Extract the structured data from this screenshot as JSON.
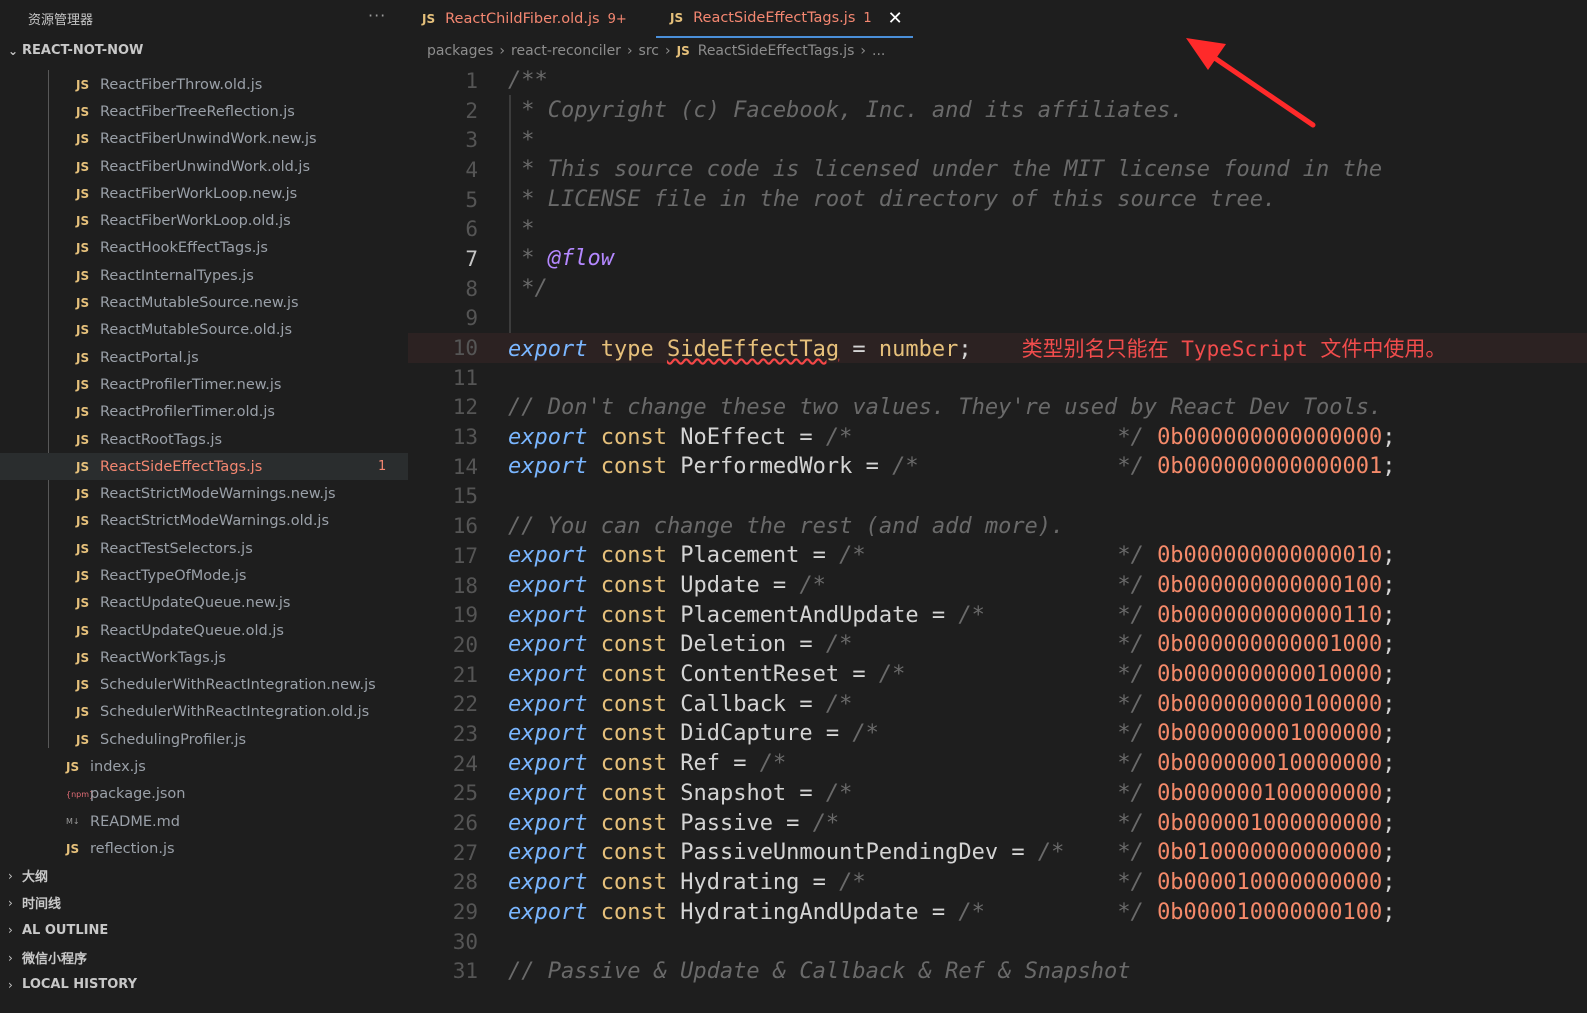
{
  "sidebar": {
    "header": "资源管理器",
    "more": "···",
    "root": "REACT-NOT-NOW",
    "files": [
      {
        "name": "ReactFiberThrow.old.js",
        "icon": "JS"
      },
      {
        "name": "ReactFiberTreeReflection.js",
        "icon": "JS"
      },
      {
        "name": "ReactFiberUnwindWork.new.js",
        "icon": "JS"
      },
      {
        "name": "ReactFiberUnwindWork.old.js",
        "icon": "JS"
      },
      {
        "name": "ReactFiberWorkLoop.new.js",
        "icon": "JS"
      },
      {
        "name": "ReactFiberWorkLoop.old.js",
        "icon": "JS"
      },
      {
        "name": "ReactHookEffectTags.js",
        "icon": "JS"
      },
      {
        "name": "ReactInternalTypes.js",
        "icon": "JS"
      },
      {
        "name": "ReactMutableSource.new.js",
        "icon": "JS"
      },
      {
        "name": "ReactMutableSource.old.js",
        "icon": "JS"
      },
      {
        "name": "ReactPortal.js",
        "icon": "JS"
      },
      {
        "name": "ReactProfilerTimer.new.js",
        "icon": "JS"
      },
      {
        "name": "ReactProfilerTimer.old.js",
        "icon": "JS"
      },
      {
        "name": "ReactRootTags.js",
        "icon": "JS"
      },
      {
        "name": "ReactSideEffectTags.js",
        "icon": "JS",
        "badge": "1"
      },
      {
        "name": "ReactStrictModeWarnings.new.js",
        "icon": "JS"
      },
      {
        "name": "ReactStrictModeWarnings.old.js",
        "icon": "JS"
      },
      {
        "name": "ReactTestSelectors.js",
        "icon": "JS"
      },
      {
        "name": "ReactTypeOfMode.js",
        "icon": "JS"
      },
      {
        "name": "ReactUpdateQueue.new.js",
        "icon": "JS"
      },
      {
        "name": "ReactUpdateQueue.old.js",
        "icon": "JS"
      },
      {
        "name": "ReactWorkTags.js",
        "icon": "JS"
      },
      {
        "name": "SchedulerWithReactIntegration.new.js",
        "icon": "JS"
      },
      {
        "name": "SchedulerWithReactIntegration.old.js",
        "icon": "JS"
      },
      {
        "name": "SchedulingProfiler.js",
        "icon": "JS"
      },
      {
        "name": "index.js",
        "icon": "JS"
      },
      {
        "name": "package.json",
        "icon": "{npm}"
      },
      {
        "name": "README.md",
        "icon": "M↓"
      },
      {
        "name": "reflection.js",
        "icon": "JS"
      }
    ],
    "sections": [
      "大纲",
      "时间线",
      "AL OUTLINE",
      "微信小程序",
      "LOCAL HISTORY"
    ]
  },
  "tabs": [
    {
      "icon": "JS",
      "name": "ReactChildFiber.old.js",
      "count": "9+"
    },
    {
      "icon": "JS",
      "name": "ReactSideEffectTags.js",
      "count": "1",
      "close": "✕"
    }
  ],
  "breadcrumb": {
    "parts": [
      "packages",
      "react-reconciler",
      "src"
    ],
    "icon": "JS",
    "file": "ReactSideEffectTags.js",
    "tail": "..."
  },
  "editor": {
    "current_line": 7,
    "error_message": "类型别名只能在 TypeScript 文件中使用。",
    "lines": [
      {
        "n": "1",
        "html": "<span class='cmt'>/**</span>"
      },
      {
        "n": "2",
        "html": "<span class='cmt'> * Copyright (c) Facebook, Inc. and its affiliates.</span>"
      },
      {
        "n": "3",
        "html": "<span class='cmt'> *</span>"
      },
      {
        "n": "4",
        "html": "<span class='cmt'> * This source code is licensed under the MIT license found in the</span>"
      },
      {
        "n": "5",
        "html": "<span class='cmt'> * LICENSE file in the root directory of this source tree.</span>"
      },
      {
        "n": "6",
        "html": "<span class='cmt'> *</span>"
      },
      {
        "n": "7",
        "html": "<span class='cmt'> * </span><span class='tag'>@flow</span>"
      },
      {
        "n": "8",
        "html": "<span class='cmt'> */</span>"
      },
      {
        "n": "9",
        "html": ""
      },
      {
        "n": "10",
        "html": "<span class='kw'>export</span> <span class='kw2'>type</span> <span class='id squig'>SideEffectTag</span> <span class='plain'>=</span> <span class='id'>number</span><span class='plain'>;</span>",
        "error": true
      },
      {
        "n": "11",
        "html": ""
      },
      {
        "n": "12",
        "html": "<span class='cmt'>// Don't change these two values. They're used by React Dev Tools.</span>"
      },
      {
        "n": "13",
        "html": "<span class='kw'>export</span> <span class='kw2'>const</span> <span class='plain'>NoEffect =</span> <span class='cmt'>/*                    */</span> <span class='num'>0b000000000000000</span><span class='plain'>;</span>"
      },
      {
        "n": "14",
        "html": "<span class='kw'>export</span> <span class='kw2'>const</span> <span class='plain'>PerformedWork =</span> <span class='cmt'>/*               */</span> <span class='num'>0b000000000000001</span><span class='plain'>;</span>"
      },
      {
        "n": "15",
        "html": ""
      },
      {
        "n": "16",
        "html": "<span class='cmt'>// You can change the rest (and add more).</span>"
      },
      {
        "n": "17",
        "html": "<span class='kw'>export</span> <span class='kw2'>const</span> <span class='plain'>Placement =</span> <span class='cmt'>/*                   */</span> <span class='num'>0b000000000000010</span><span class='plain'>;</span>"
      },
      {
        "n": "18",
        "html": "<span class='kw'>export</span> <span class='kw2'>const</span> <span class='plain'>Update =</span> <span class='cmt'>/*                      */</span> <span class='num'>0b000000000000100</span><span class='plain'>;</span>"
      },
      {
        "n": "19",
        "html": "<span class='kw'>export</span> <span class='kw2'>const</span> <span class='plain'>PlacementAndUpdate =</span> <span class='cmt'>/*          */</span> <span class='num'>0b000000000000110</span><span class='plain'>;</span>"
      },
      {
        "n": "20",
        "html": "<span class='kw'>export</span> <span class='kw2'>const</span> <span class='plain'>Deletion =</span> <span class='cmt'>/*                    */</span> <span class='num'>0b000000000001000</span><span class='plain'>;</span>"
      },
      {
        "n": "21",
        "html": "<span class='kw'>export</span> <span class='kw2'>const</span> <span class='plain'>ContentReset =</span> <span class='cmt'>/*                */</span> <span class='num'>0b000000000010000</span><span class='plain'>;</span>"
      },
      {
        "n": "22",
        "html": "<span class='kw'>export</span> <span class='kw2'>const</span> <span class='plain'>Callback =</span> <span class='cmt'>/*                    */</span> <span class='num'>0b000000000100000</span><span class='plain'>;</span>"
      },
      {
        "n": "23",
        "html": "<span class='kw'>export</span> <span class='kw2'>const</span> <span class='plain'>DidCapture =</span> <span class='cmt'>/*                  */</span> <span class='num'>0b000000001000000</span><span class='plain'>;</span>"
      },
      {
        "n": "24",
        "html": "<span class='kw'>export</span> <span class='kw2'>const</span> <span class='plain'>Ref =</span> <span class='cmt'>/*                         */</span> <span class='num'>0b000000010000000</span><span class='plain'>;</span>"
      },
      {
        "n": "25",
        "html": "<span class='kw'>export</span> <span class='kw2'>const</span> <span class='plain'>Snapshot =</span> <span class='cmt'>/*                    */</span> <span class='num'>0b000000100000000</span><span class='plain'>;</span>"
      },
      {
        "n": "26",
        "html": "<span class='kw'>export</span> <span class='kw2'>const</span> <span class='plain'>Passive =</span> <span class='cmt'>/*                     */</span> <span class='num'>0b000001000000000</span><span class='plain'>;</span>"
      },
      {
        "n": "27",
        "html": "<span class='kw'>export</span> <span class='kw2'>const</span> <span class='plain'>PassiveUnmountPendingDev =</span> <span class='cmt'>/*    */</span> <span class='num'>0b010000000000000</span><span class='plain'>;</span>"
      },
      {
        "n": "28",
        "html": "<span class='kw'>export</span> <span class='kw2'>const</span> <span class='plain'>Hydrating =</span> <span class='cmt'>/*                   */</span> <span class='num'>0b000010000000000</span><span class='plain'>;</span>"
      },
      {
        "n": "29",
        "html": "<span class='kw'>export</span> <span class='kw2'>const</span> <span class='plain'>HydratingAndUpdate =</span> <span class='cmt'>/*          */</span> <span class='num'>0b000010000000100</span><span class='plain'>;</span>"
      },
      {
        "n": "30",
        "html": ""
      },
      {
        "n": "31",
        "html": "<span class='cmt'>// Passive &amp; Update &amp; Callback &amp; Ref &amp; Snapshot</span>"
      }
    ]
  },
  "colors": {
    "accent_tab": "#4a8fd9",
    "error": "#f14c4c",
    "annotation_arrow": "#ff2a2a"
  }
}
